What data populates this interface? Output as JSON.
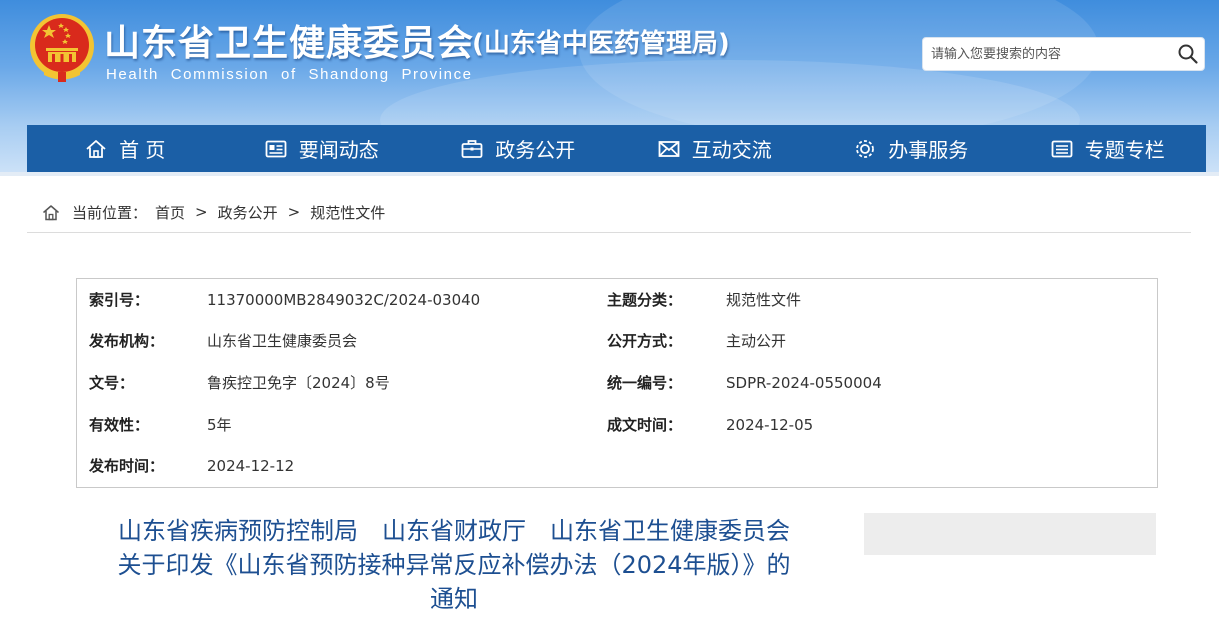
{
  "header": {
    "title": "山东省卫生健康委员会",
    "subtitle": "(山东省中医药管理局)",
    "english": "Health Commission of Shandong Province",
    "colors": {
      "nav": "#1b5fa6",
      "title": "#ffffff",
      "doc_title": "#1d4f91",
      "emblem_red": "#d92a1c",
      "emblem_gold": "#f3c433"
    }
  },
  "search": {
    "placeholder": "请输入您要搜索的内容",
    "value": "",
    "icon": "search-icon"
  },
  "nav": {
    "items": [
      {
        "label": "首 页",
        "icon": "home-icon"
      },
      {
        "label": "要闻动态",
        "icon": "news-icon"
      },
      {
        "label": "政务公开",
        "icon": "briefcase-icon"
      },
      {
        "label": "互动交流",
        "icon": "mail-icon"
      },
      {
        "label": "办事服务",
        "icon": "service-icon"
      },
      {
        "label": "专题专栏",
        "icon": "list-icon"
      }
    ]
  },
  "breadcrumb": {
    "label": "当前位置：",
    "items": [
      "首页",
      "政务公开",
      "规范性文件"
    ],
    "separator": ">"
  },
  "meta": {
    "index_no": {
      "key": "索引号：",
      "value": "11370000MB2849032C/2024-03040"
    },
    "topic": {
      "key": "主题分类：",
      "value": "规范性文件"
    },
    "publisher": {
      "key": "发布机构：",
      "value": "山东省卫生健康委员会"
    },
    "open_mode": {
      "key": "公开方式：",
      "value": "主动公开"
    },
    "doc_no": {
      "key": "文号：",
      "value": "鲁疾控卫免字〔2024〕8号"
    },
    "unified_no": {
      "key": "统一编号：",
      "value": "SDPR-2024-0550004"
    },
    "validity": {
      "key": "有效性：",
      "value": "5年"
    },
    "created": {
      "key": "成文时间：",
      "value": "2024-12-05"
    },
    "published": {
      "key": "发布时间：",
      "value": "2024-12-12"
    }
  },
  "document": {
    "title_line1": "山东省疾病预防控制局　山东省财政厅　山东省卫生健康委员会",
    "title_line2": "关于印发《山东省预防接种异常反应补偿办法（2024年版）》的",
    "title_line3": "通知"
  }
}
